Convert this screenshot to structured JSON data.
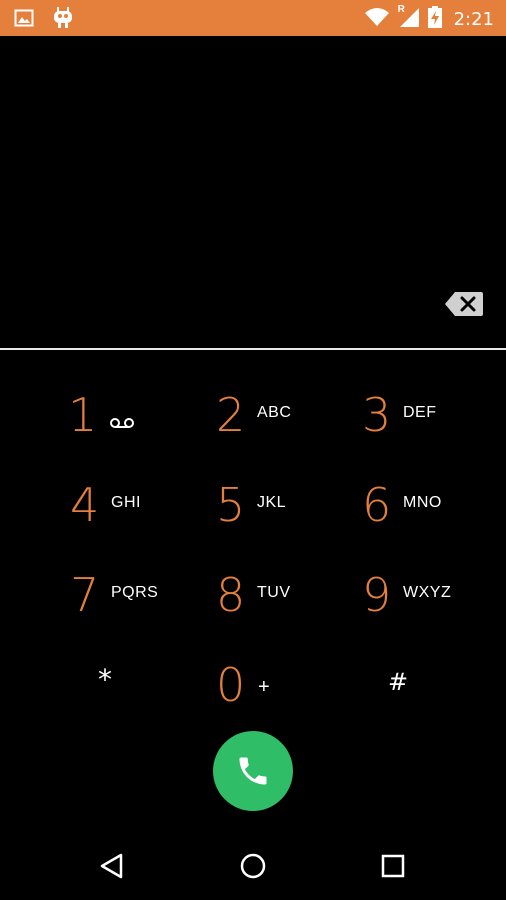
{
  "status_bar": {
    "time": "2:21",
    "roaming_indicator": "R",
    "icons": [
      "image-notification-icon",
      "cyanogenmod-mascot-icon",
      "wifi-icon",
      "cell-signal-icon",
      "battery-charging-icon"
    ],
    "background_color": "#e47f3c"
  },
  "display": {
    "number": ""
  },
  "keypad": {
    "accent_color": "#e47f3c",
    "keys": [
      {
        "digit": "1",
        "letters": ""
      },
      {
        "digit": "2",
        "letters": "ABC"
      },
      {
        "digit": "3",
        "letters": "DEF"
      },
      {
        "digit": "4",
        "letters": "GHI"
      },
      {
        "digit": "5",
        "letters": "JKL"
      },
      {
        "digit": "6",
        "letters": "MNO"
      },
      {
        "digit": "7",
        "letters": "PQRS"
      },
      {
        "digit": "8",
        "letters": "TUV"
      },
      {
        "digit": "9",
        "letters": "WXYZ"
      },
      {
        "digit": "*",
        "letters": ""
      },
      {
        "digit": "0",
        "letters": "+"
      },
      {
        "digit": "#",
        "letters": ""
      }
    ]
  },
  "call_button": {
    "color": "#2fbe67",
    "icon": "phone-icon"
  },
  "nav_bar": {
    "icons": [
      "back-icon",
      "home-icon",
      "recents-icon"
    ]
  }
}
